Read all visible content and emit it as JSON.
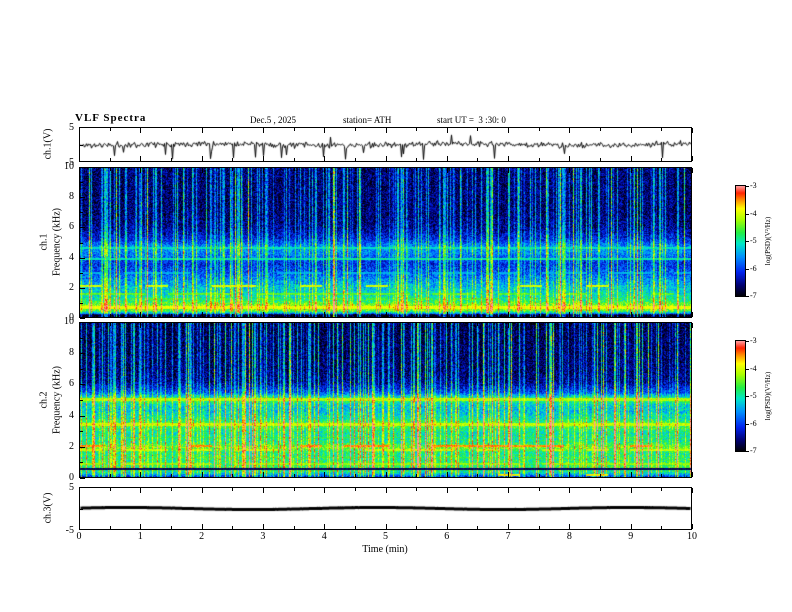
{
  "header": {
    "title": "VLF Spectra",
    "date": "Dec.5 , 2025",
    "station": "station= ATH",
    "start_ut": "start UT =  3 :30: 0"
  },
  "xaxis": {
    "label": "Time (min)",
    "range": [
      0,
      10
    ],
    "ticks": [
      0,
      1,
      2,
      3,
      4,
      5,
      6,
      7,
      8,
      9,
      10
    ]
  },
  "colorbar": {
    "label": "log(PSD)(V²/Hz)",
    "range": [
      -7,
      -3
    ],
    "ticks": [
      -3,
      -4,
      -5,
      -6,
      -7
    ]
  },
  "colormap": {
    "stops": [
      [
        0.0,
        "#000000"
      ],
      [
        0.1,
        "#00006e"
      ],
      [
        0.22,
        "#0022ee"
      ],
      [
        0.36,
        "#0090ff"
      ],
      [
        0.48,
        "#00e8c8"
      ],
      [
        0.58,
        "#22ee44"
      ],
      [
        0.7,
        "#aaff00"
      ],
      [
        0.8,
        "#ffff00"
      ],
      [
        0.88,
        "#ff8800"
      ],
      [
        0.94,
        "#ff2200"
      ],
      [
        1.0,
        "#ff9999"
      ]
    ]
  },
  "chart_data": [
    {
      "id": "ch1-voltage",
      "type": "line",
      "ylabel": "ch.1(V)",
      "ylim": [
        -5,
        5
      ],
      "yticks": [
        5,
        -5
      ],
      "description": "broadband noisy voltage trace around 0 V with many impulsive downward spikes",
      "signal": {
        "baseline": 0,
        "noise_amp": 0.85,
        "spike_down_prob": 0.025,
        "spike_up_prob": 0.006,
        "seed": 11,
        "thick": 1
      }
    },
    {
      "id": "ch1-spectrogram",
      "type": "heatmap",
      "row_label": "ch.1",
      "ylabel": "Frequency (kHz)",
      "ylim": [
        0,
        10
      ],
      "xlim": [
        0,
        10
      ],
      "yticks": [
        0,
        2,
        4,
        6,
        8,
        10
      ],
      "value_range": [
        -7,
        -3
      ],
      "seed": 21,
      "description": "VLF spectrogram: dark-blue background above 5 kHz with dense vertical sferic streaks, green/cyan below 3 kHz, bright yellow band near 0.5-0.9 kHz, black band below 0.2 kHz, intermittent brown line near 2.1 kHz",
      "profile": [
        [
          0,
          -7
        ],
        [
          0.18,
          -7
        ],
        [
          0.25,
          -5.8
        ],
        [
          0.45,
          -4.5
        ],
        [
          0.8,
          -4.3
        ],
        [
          1.1,
          -4.8
        ],
        [
          1.5,
          -5.1
        ],
        [
          2,
          -5.3
        ],
        [
          2.5,
          -5.6
        ],
        [
          3,
          -5.9
        ],
        [
          3.6,
          -6.1
        ],
        [
          4.2,
          -5.7
        ],
        [
          4.7,
          -5.5
        ],
        [
          5.2,
          -6.1
        ],
        [
          6,
          -6.5
        ],
        [
          7,
          -6.6
        ],
        [
          10,
          -6.6
        ]
      ],
      "lines": [
        {
          "f": 4.65,
          "w": 0.07,
          "level": -5.1,
          "duty": 1,
          "dark": false
        },
        {
          "f": 3.95,
          "w": 0.06,
          "level": -5.0,
          "duty": 1,
          "dark": false
        },
        {
          "f": 3.0,
          "w": 0.05,
          "level": -5.4,
          "duty": 0.5,
          "dark": false
        },
        {
          "f": 2.1,
          "w": 0.08,
          "level": -4.0,
          "duty": 0.3,
          "dark": false
        },
        {
          "f": 1.6,
          "w": 0.07,
          "level": -4.5,
          "duty": 0.5,
          "dark": false
        },
        {
          "f": 1.25,
          "w": 0.05,
          "level": -4.6,
          "duty": 0.4,
          "dark": false
        },
        {
          "f": 0.65,
          "w": 0.1,
          "level": -3.9,
          "duty": 1,
          "dark": false
        }
      ],
      "impulses": {
        "prob": 0.3,
        "strong_prob": 0.06,
        "boost": 1.3,
        "strong_boost": 2.6
      }
    },
    {
      "id": "ch2-spectrogram",
      "type": "heatmap",
      "row_label": "ch.2",
      "ylabel": "Frequency (kHz)",
      "ylim": [
        0,
        10
      ],
      "xlim": [
        0,
        10
      ],
      "yticks": [
        0,
        2,
        4,
        6,
        8,
        10
      ],
      "value_range": [
        -7,
        -3
      ],
      "seed": 57,
      "description": "VLF spectrogram: blue with sferic streaks above 5.5 kHz, bright green/yellow below 5 kHz, yellow bands near 5.0 and 3.45 kHz, strong intermittent red-brown line near 2 kHz, dark line near 0.55 kHz",
      "profile": [
        [
          0,
          -6.3
        ],
        [
          0.15,
          -5.6
        ],
        [
          0.35,
          -5
        ],
        [
          0.7,
          -4.7
        ],
        [
          1.1,
          -4.8
        ],
        [
          1.6,
          -4.9
        ],
        [
          1.95,
          -4.4
        ],
        [
          2.3,
          -4.9
        ],
        [
          2.9,
          -5
        ],
        [
          3.45,
          -4.5
        ],
        [
          3.8,
          -5
        ],
        [
          4.3,
          -5.3
        ],
        [
          4.75,
          -5.2
        ],
        [
          5.05,
          -4.6
        ],
        [
          5.5,
          -5.9
        ],
        [
          6.2,
          -6.5
        ],
        [
          7,
          -6.6
        ],
        [
          10,
          -6.7
        ]
      ],
      "lines": [
        {
          "f": 5.05,
          "w": 0.09,
          "level": -4.2,
          "duty": 1,
          "dark": false
        },
        {
          "f": 3.45,
          "w": 0.08,
          "level": -4.1,
          "duty": 1,
          "dark": false
        },
        {
          "f": 2.6,
          "w": 0.05,
          "level": -4.7,
          "duty": 0.5,
          "dark": false
        },
        {
          "f": 2.05,
          "w": 0.08,
          "level": -3.5,
          "duty": 0.4,
          "dark": false
        },
        {
          "f": 1.8,
          "w": 0.06,
          "level": -4.1,
          "duty": 0.6,
          "dark": false
        },
        {
          "f": 1.3,
          "w": 0.05,
          "level": -4.6,
          "duty": 0.5,
          "dark": false
        },
        {
          "f": 0.9,
          "w": 0.07,
          "level": -4.3,
          "duty": 0.9,
          "dark": false
        },
        {
          "f": 0.55,
          "w": 0.05,
          "level": -6.7,
          "duty": 1,
          "dark": true
        },
        {
          "f": 0.18,
          "w": 0.06,
          "level": -3.8,
          "duty": 0.15,
          "dark": false
        }
      ],
      "impulses": {
        "prob": 0.3,
        "strong_prob": 0.06,
        "boost": 1.3,
        "strong_boost": 2.6
      }
    },
    {
      "id": "ch3-voltage",
      "type": "line",
      "ylabel": "ch.3(V)",
      "ylim": [
        -5,
        5
      ],
      "yticks": [
        5,
        -5
      ],
      "description": "flat line at 0 V (channel off / no signal)",
      "signal": {
        "baseline": 0,
        "noise_amp": 0.02,
        "spike_down_prob": 0,
        "spike_up_prob": 0,
        "seed": 13,
        "thick": 3
      }
    }
  ]
}
